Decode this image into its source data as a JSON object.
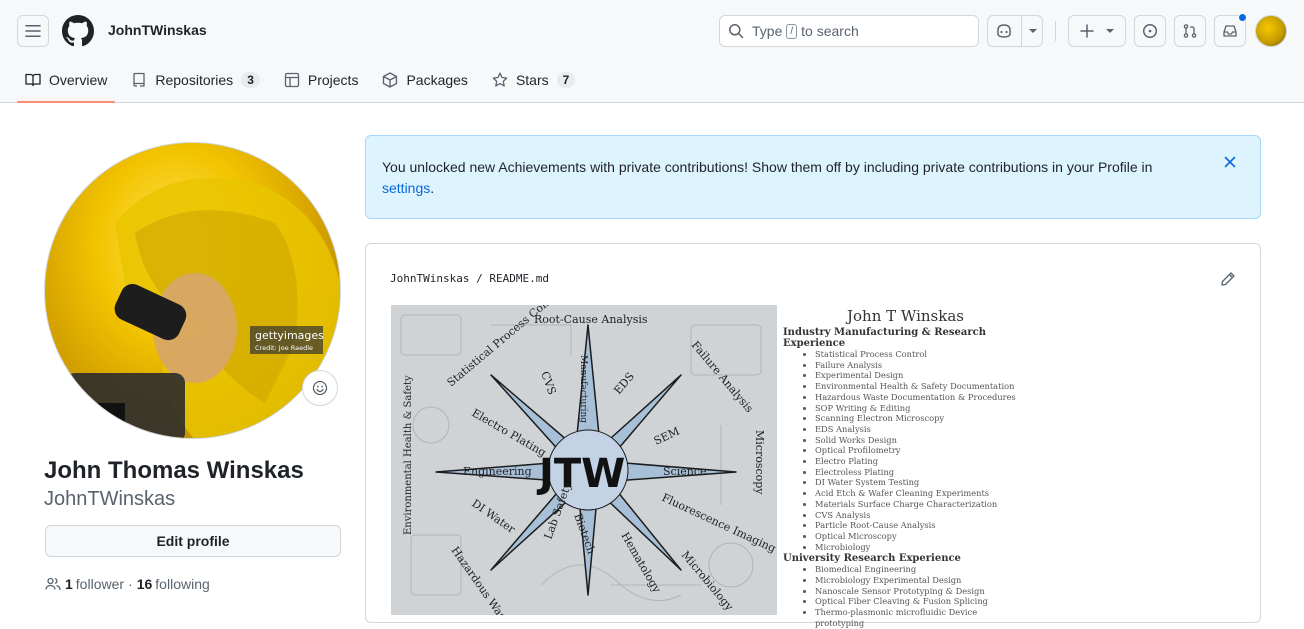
{
  "header": {
    "username": "JohnTWinskas",
    "search": {
      "before": "Type",
      "key": "/",
      "after": "to search"
    }
  },
  "tabs": [
    {
      "label": "Overview"
    },
    {
      "label": "Repositories",
      "count": "3"
    },
    {
      "label": "Projects"
    },
    {
      "label": "Packages"
    },
    {
      "label": "Stars",
      "count": "7"
    }
  ],
  "profile": {
    "full_name": "John Thomas Winskas",
    "login": "JohnTWinskas",
    "edit_label": "Edit profile",
    "followers": "1",
    "followers_label": "follower",
    "separator": "·",
    "following": "16",
    "following_label": "following",
    "avatar_watermark": "gettyimages",
    "avatar_credit": "Credit: Joe Raedle"
  },
  "flash": {
    "text": "You unlocked new Achievements with private contributions! Show them off by including private contributions in your Profile in",
    "link": "settings",
    "end": "."
  },
  "readme": {
    "owner": "JohnTWinskas",
    "sep": "/",
    "file": "README.md",
    "banner": {
      "compass_center": "JTW",
      "compass_labels": [
        "Root-Cause Analysis",
        "Statistical Process Control",
        "Failure Analysis",
        "Electro Plating",
        "EDS",
        "SEM",
        "Engineering",
        "Science",
        "Microscopy",
        "Environmental Health & Safety",
        "DI Water",
        "Biotech",
        "Fluorescence Imaging",
        "Hazardous Waste",
        "Lab Safety",
        "Hematology",
        "Microbiology",
        "Manufacturing",
        "CVS"
      ],
      "title": "John T Winskas",
      "section1": "Industry Manufacturing & Research Experience",
      "items1": [
        "Statistical Process Control",
        "Failure Analysis",
        "Experimental Design",
        "Environmental Health & Safety Documentation",
        "Hazardous Waste Documentation & Procedures",
        "SOP Writing & Editing",
        "Scanning Electron Microscopy",
        "EDS Analysis",
        "Solid Works Design",
        "Optical Profilometry",
        "Electro Plating",
        "Electroless Plating",
        "DI Water System Testing",
        "Acid Etch & Wafer Cleaning Experiments",
        "Materials Surface Charge Characterization",
        "CVS Analysis",
        "Particle Root-Cause Analysis",
        "Optical Microscopy",
        "Microbiology"
      ],
      "section2": "University Research Experience",
      "items2": [
        "Biomedical Engineering",
        "Microbiology Experimental Design",
        "Nanoscale Sensor Prototyping & Design",
        "Optical Fiber Cleaving & Fusion Splicing",
        "Thermo-plasmonic microfluidic Device prototyping"
      ]
    }
  }
}
